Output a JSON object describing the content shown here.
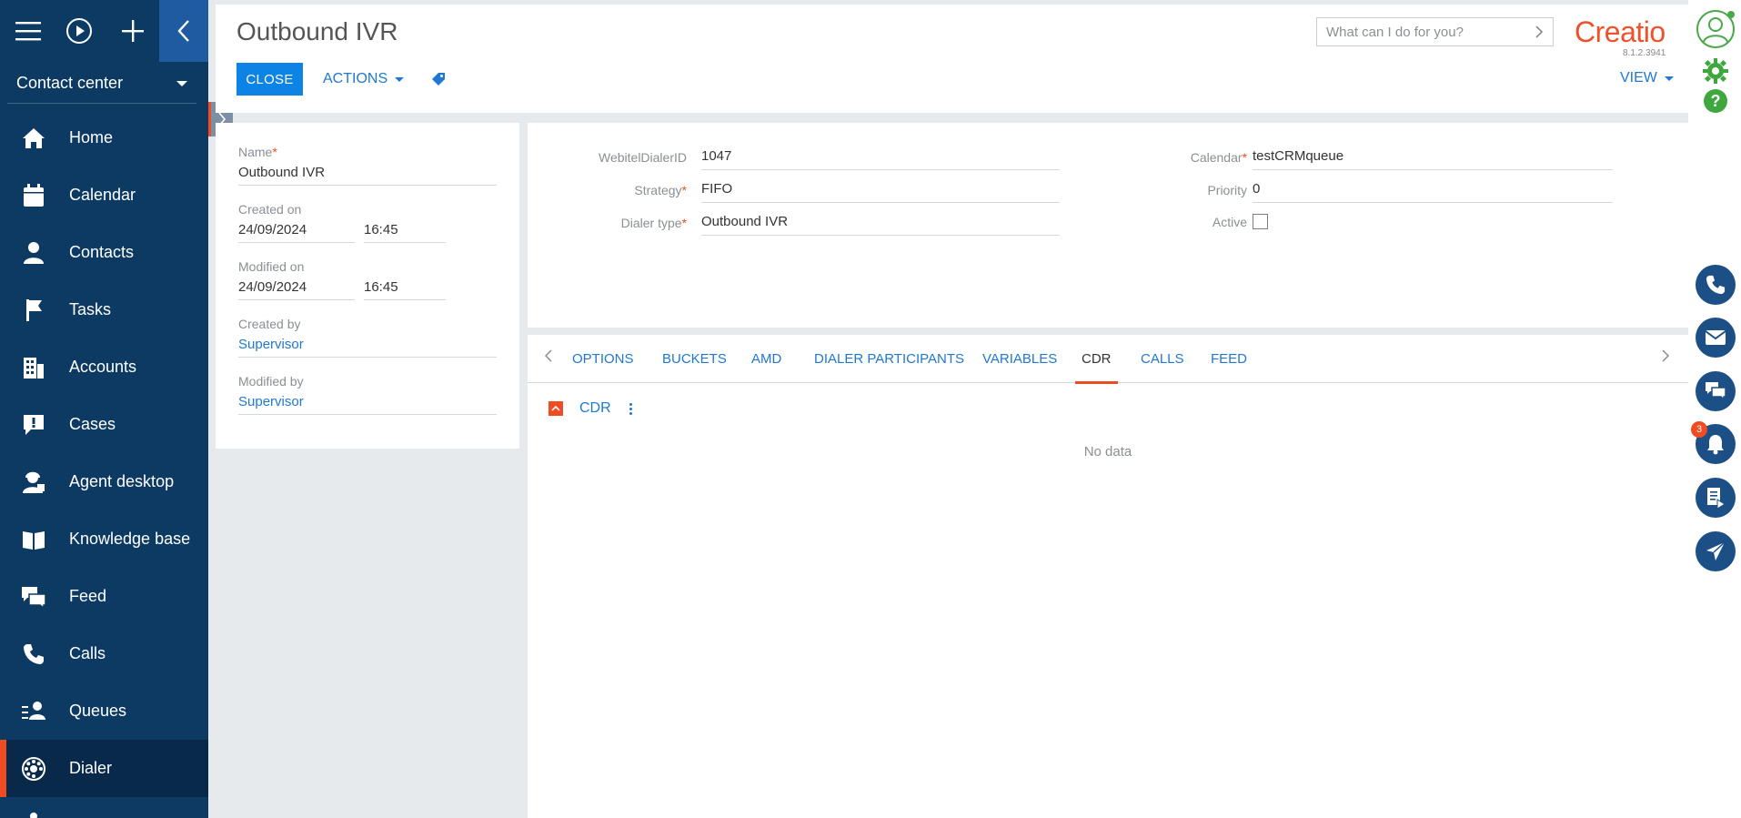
{
  "workplace": {
    "label": "Contact center"
  },
  "nav": {
    "items": [
      {
        "label": "Home",
        "icon": "home-icon"
      },
      {
        "label": "Calendar",
        "icon": "calendar-icon"
      },
      {
        "label": "Contacts",
        "icon": "contact-icon"
      },
      {
        "label": "Tasks",
        "icon": "flag-icon"
      },
      {
        "label": "Accounts",
        "icon": "building-icon"
      },
      {
        "label": "Cases",
        "icon": "case-icon"
      },
      {
        "label": "Agent desktop",
        "icon": "agent-icon"
      },
      {
        "label": "Knowledge base",
        "icon": "book-icon"
      },
      {
        "label": "Feed",
        "icon": "feed-icon"
      },
      {
        "label": "Calls",
        "icon": "phone-icon"
      },
      {
        "label": "Queues",
        "icon": "queue-icon"
      },
      {
        "label": "Dialer",
        "icon": "dialer-icon"
      }
    ],
    "active": "Dialer"
  },
  "header": {
    "title": "Outbound IVR",
    "close_label": "CLOSE",
    "actions_label": "ACTIONS",
    "view_label": "VIEW",
    "search_placeholder": "What can I do for you?",
    "logo": "Creatio",
    "version": "8.1.2.3941"
  },
  "info": {
    "name_label": "Name",
    "name_value": "Outbound IVR",
    "created_on_label": "Created on",
    "created_on_date": "24/09/2024",
    "created_on_time": "16:45",
    "modified_on_label": "Modified on",
    "modified_on_date": "24/09/2024",
    "modified_on_time": "16:45",
    "created_by_label": "Created by",
    "created_by_value": "Supervisor",
    "modified_by_label": "Modified by",
    "modified_by_value": "Supervisor"
  },
  "form": {
    "dialer_id_label": "WebitelDialerID",
    "dialer_id_value": "1047",
    "strategy_label": "Strategy",
    "strategy_value": "FIFO",
    "dialer_type_label": "Dialer type",
    "dialer_type_value": "Outbound IVR",
    "calendar_label": "Calendar",
    "calendar_value": "testCRMqueue",
    "priority_label": "Priority",
    "priority_value": "0",
    "active_label": "Active",
    "active_checked": false
  },
  "tabs": {
    "items": [
      "OPTIONS",
      "BUCKETS",
      "AMD",
      "DIALER PARTICIPANTS",
      "VARIABLES",
      "CDR",
      "CALLS",
      "FEED"
    ],
    "active": "CDR"
  },
  "detail": {
    "caption": "CDR",
    "empty_text": "No data"
  },
  "rail": {
    "notification_count": "3"
  },
  "colors": {
    "sidebar": "#0c3a63",
    "accent": "#f04c23",
    "primary": "#0d84e5",
    "link": "#1f78d1"
  }
}
